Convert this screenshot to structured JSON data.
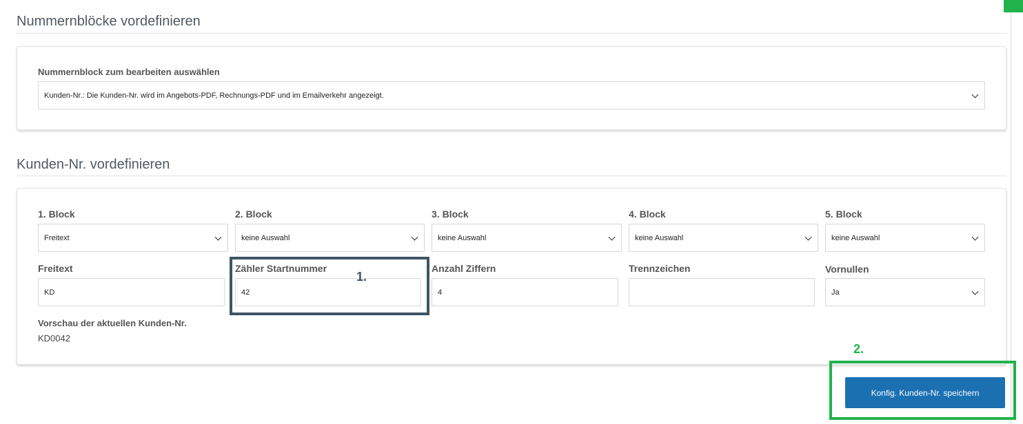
{
  "section1": {
    "title": "Nummernblöcke vordefinieren",
    "select_label": "Nummernblock zum bearbeiten auswählen",
    "select_value": "Kunden-Nr.: Die Kunden-Nr. wird im Angebots-PDF, Rechnungs-PDF und im Emailverkehr angezeigt."
  },
  "section2": {
    "title": "Kunden-Nr. vordefinieren",
    "blocks": [
      {
        "label": "1. Block",
        "value": "Freitext"
      },
      {
        "label": "2. Block",
        "value": "keine Auswahl"
      },
      {
        "label": "3. Block",
        "value": "keine Auswahl"
      },
      {
        "label": "4. Block",
        "value": "keine Auswahl"
      },
      {
        "label": "5. Block",
        "value": "keine Auswahl"
      }
    ],
    "fields": {
      "freitext": {
        "label": "Freitext",
        "value": "KD"
      },
      "counter_start": {
        "label": "Zähler Startnummer",
        "value": "42"
      },
      "digits": {
        "label": "Anzahl Ziffern",
        "value": "4"
      },
      "separator": {
        "label": "Trennzeichen",
        "value": ""
      },
      "leading_zeros": {
        "label": "Vornullen",
        "value": "Ja"
      }
    },
    "preview_label": "Vorschau der aktuellen Kunden-Nr.",
    "preview_value": "KD0042"
  },
  "annotations": {
    "marker1": "1.",
    "marker2": "2."
  },
  "save_button_label": "Konfig. Kunden-Nr. speichern",
  "colors": {
    "accent_green": "#21b24b",
    "highlight_dark": "#3f5565",
    "button_blue": "#1b70b2"
  }
}
